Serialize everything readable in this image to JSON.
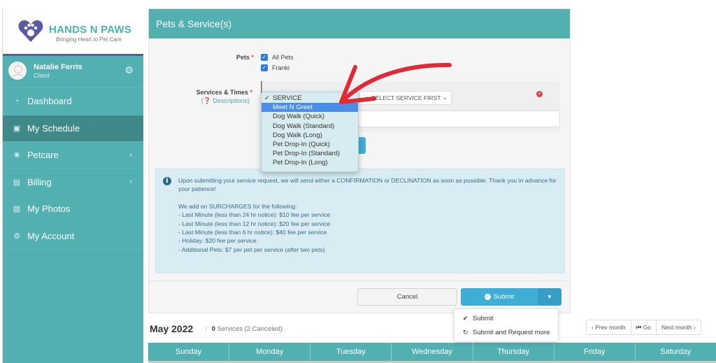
{
  "brand": {
    "name": "HANDS N PAWS",
    "tagline": "Bringing Heart to Pet Care",
    "accent": "#52b0b0",
    "brand_purple": "#5b5aa6"
  },
  "user": {
    "name": "Natalie Ferris",
    "role": "Client"
  },
  "sidebar": {
    "items": [
      {
        "label": "Dashboard",
        "icon": "dashboard-icon",
        "active": false,
        "has_submenu": false
      },
      {
        "label": "My Schedule",
        "icon": "calendar-icon",
        "active": true,
        "has_submenu": false
      },
      {
        "label": "Petcare",
        "icon": "paw-icon",
        "active": false,
        "has_submenu": true
      },
      {
        "label": "Billing",
        "icon": "document-icon",
        "active": false,
        "has_submenu": true
      },
      {
        "label": "My Photos",
        "icon": "image-icon",
        "active": false,
        "has_submenu": false
      },
      {
        "label": "My Account",
        "icon": "cogs-icon",
        "active": false,
        "has_submenu": false
      }
    ]
  },
  "panel": {
    "title": "Pets & Service(s)",
    "pets_label": "Pets",
    "pets": [
      {
        "label": "All Pets",
        "checked": true
      },
      {
        "label": "Franki",
        "checked": true
      }
    ],
    "services_label": "Services & Times",
    "descriptions_link": "Descriptions",
    "secondary_select": "<- SELECT SERVICE FIRST",
    "service_dropdown": {
      "options": [
        {
          "label": "SERVICE",
          "checked": true,
          "highlighted": false
        },
        {
          "label": "Meet N Greet",
          "checked": false,
          "highlighted": true
        },
        {
          "label": "Dog Walk (Quick)",
          "checked": false,
          "highlighted": false
        },
        {
          "label": "Dog Walk (Standard)",
          "checked": false,
          "highlighted": false
        },
        {
          "label": "Dog Walk (Long)",
          "checked": false,
          "highlighted": false
        },
        {
          "label": "Pet Drop-In (Quick)",
          "checked": false,
          "highlighted": false
        },
        {
          "label": "Pet Drop-In (Standard)",
          "checked": false,
          "highlighted": false
        },
        {
          "label": "Pet Drop-In (Long)",
          "checked": false,
          "highlighted": false
        }
      ]
    },
    "info": {
      "intro": "Upon submitting your service request, we will send either a CONFIRMATION or DECLINATION as soon as possible. Thank you in advance for your patience!",
      "surcharge_heading": "We add on SURCHARGES for the following:",
      "surcharges": [
        "- Last Minute (less than 24 hr notice): $10 fee per service",
        "- Last Minute (less than 12 hr notice): $20 fee per service",
        "- Last Minute (less than 6 hr notice): $40 fee per service",
        "- Holiday: $20 fee per service",
        "- Additional Pets: $7 per pet per service (after two pets)"
      ]
    },
    "cancel_label": "Cancel",
    "submit_label": "Submit",
    "submit_menu": [
      {
        "label": "Submit",
        "icon": "check-circle-icon"
      },
      {
        "label": "Submit and Request more",
        "icon": "refresh-icon"
      }
    ]
  },
  "calendar": {
    "month": "May 2022",
    "separator": "/",
    "services_count": "0",
    "services_text": "Services (2 Canceled)",
    "nav": {
      "prev": "‹ Prev month",
      "go": "Go",
      "next": "Next month ›"
    },
    "days": [
      "Sunday",
      "Monday",
      "Tuesday",
      "Wednesday",
      "Thursday",
      "Friday",
      "Saturday"
    ]
  }
}
